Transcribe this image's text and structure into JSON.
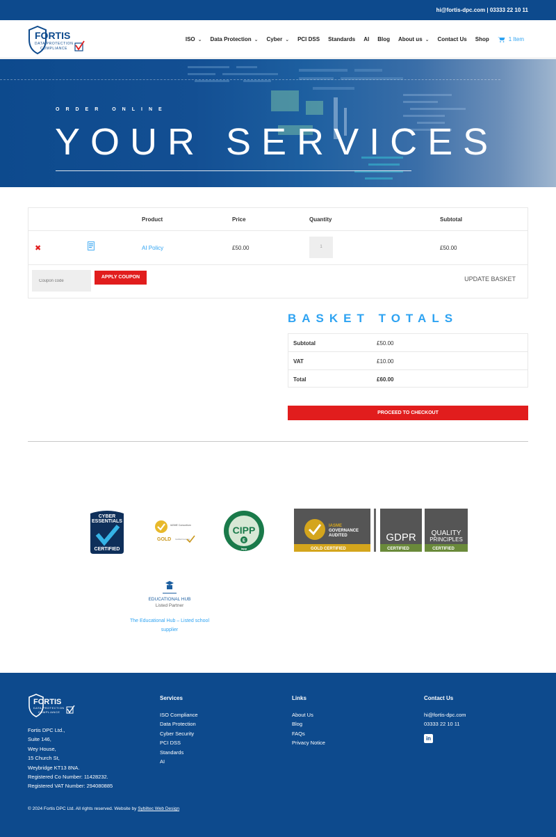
{
  "topbar": {
    "contact": "hi@fortis-dpc.com | 03333 22 10 11"
  },
  "logo": {
    "name": "FORTIS",
    "tagline1": "DATA PROTECTION",
    "tagline2": "COMPLIANCE"
  },
  "nav": {
    "items": [
      {
        "label": "ISO",
        "dropdown": true
      },
      {
        "label": "Data Protection",
        "dropdown": true
      },
      {
        "label": "Cyber",
        "dropdown": true
      },
      {
        "label": "PCI DSS",
        "dropdown": false
      },
      {
        "label": "Standards",
        "dropdown": false
      },
      {
        "label": "AI",
        "dropdown": false
      },
      {
        "label": "Blog",
        "dropdown": false
      },
      {
        "label": "About us",
        "dropdown": true
      },
      {
        "label": "Contact Us",
        "dropdown": false
      },
      {
        "label": "Shop",
        "dropdown": false
      }
    ],
    "cart_label": "1 Item"
  },
  "hero": {
    "eyebrow": "ORDER ONLINE",
    "title": "YOUR SERVICES"
  },
  "cart": {
    "headers": {
      "product": "Product",
      "price": "Price",
      "quantity": "Quantity",
      "subtotal": "Subtotal"
    },
    "row": {
      "remove": "✖",
      "product": "AI Policy",
      "price": "£50.00",
      "quantity": "1",
      "subtotal": "£50.00"
    },
    "coupon_placeholder": "Coupon code",
    "apply_label": "APPLY COUPON",
    "update_label": "UPDATE BASKET"
  },
  "totals": {
    "title": "BASKET TOTALS",
    "rows": [
      {
        "label": "Subtotal",
        "value": "£50.00"
      },
      {
        "label": "VAT",
        "value": "£10.00"
      },
      {
        "label": "Total",
        "value": "£60.00"
      }
    ],
    "checkout_label": "PROCEED TO CHECKOUT"
  },
  "badges": {
    "cyber": {
      "line1": "CYBER",
      "line2": "ESSENTIALS",
      "line3": "CERTIFIED"
    },
    "iasme": {
      "small": "IASME Consortium",
      "gold": "GOLD",
      "certified": "Certified Company"
    },
    "cipp": {
      "main": "CIPP",
      "sub": "E",
      "foot": "iapp"
    },
    "governance": {
      "line1": "IASME",
      "line2": "GOVERNANCE",
      "line3": "AUDITED",
      "foot": "GOLD CERTIFIED"
    },
    "gdpr": {
      "main": "GDPR",
      "foot": "CERTIFIED"
    },
    "quality": {
      "line1": "QUALITY",
      "line2": "PRINCIPLES",
      "foot": "CERTIFIED"
    },
    "edu": {
      "line1": "EDUCATIONAL HUB",
      "line2": "Listed Partner",
      "link": "The Educational Hub – Listed school supplier"
    }
  },
  "footer": {
    "address": [
      "Fortis DPC Ltd.,",
      "Suite 146,",
      "Wey House,",
      "15 Church St,",
      "Weybridge KT13 8NA.",
      "Registered Co Number: 11428232.",
      "Registered VAT Number: 294080885"
    ],
    "services": {
      "title": "Services",
      "items": [
        "ISO Compliance",
        "Data Protection",
        "Cyber Security",
        "PCI DSS",
        "Standards",
        "AI"
      ]
    },
    "links": {
      "title": "Links",
      "items": [
        "About Us",
        "Blog",
        "FAQs",
        "Privacy Notice"
      ]
    },
    "contact": {
      "title": "Contact Us",
      "email": "hi@fortis-dpc.com",
      "phone": "03333 22 10 11"
    },
    "copyright": "© 2024 Fortis DPC Ltd. All rights reserved. Website by",
    "credit": "Sybiltec Web Design"
  },
  "colors": {
    "primary": "#0d4a8d",
    "accent": "#2ea3f2",
    "cta": "#e11d1d"
  }
}
